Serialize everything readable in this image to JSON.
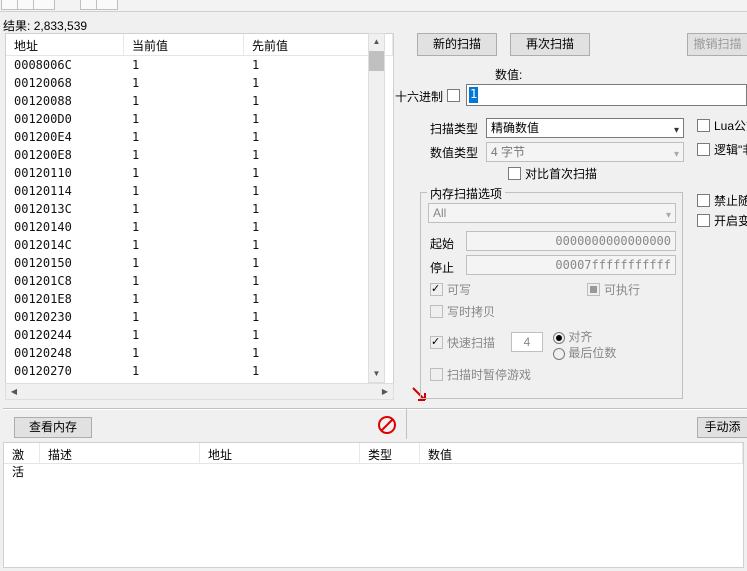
{
  "result_label_prefix": "结果:",
  "result_count": "2,833,539",
  "columns": {
    "addr": "地址",
    "curr": "当前值",
    "prev": "先前值"
  },
  "rows": [
    {
      "addr": "0008006C",
      "curr": "1",
      "prev": "1"
    },
    {
      "addr": "00120068",
      "curr": "1",
      "prev": "1"
    },
    {
      "addr": "00120088",
      "curr": "1",
      "prev": "1"
    },
    {
      "addr": "001200D0",
      "curr": "1",
      "prev": "1"
    },
    {
      "addr": "001200E4",
      "curr": "1",
      "prev": "1"
    },
    {
      "addr": "001200E8",
      "curr": "1",
      "prev": "1"
    },
    {
      "addr": "00120110",
      "curr": "1",
      "prev": "1"
    },
    {
      "addr": "00120114",
      "curr": "1",
      "prev": "1"
    },
    {
      "addr": "0012013C",
      "curr": "1",
      "prev": "1"
    },
    {
      "addr": "00120140",
      "curr": "1",
      "prev": "1"
    },
    {
      "addr": "0012014C",
      "curr": "1",
      "prev": "1"
    },
    {
      "addr": "00120150",
      "curr": "1",
      "prev": "1"
    },
    {
      "addr": "001201C8",
      "curr": "1",
      "prev": "1"
    },
    {
      "addr": "001201E8",
      "curr": "1",
      "prev": "1"
    },
    {
      "addr": "00120230",
      "curr": "1",
      "prev": "1"
    },
    {
      "addr": "00120244",
      "curr": "1",
      "prev": "1"
    },
    {
      "addr": "00120248",
      "curr": "1",
      "prev": "1"
    },
    {
      "addr": "00120270",
      "curr": "1",
      "prev": "1"
    }
  ],
  "buttons": {
    "new_scan": "新的扫描",
    "next_scan": "再次扫描",
    "undo_scan": "撤销扫描",
    "view_mem": "查看内存",
    "manual_add": "手动添"
  },
  "labels": {
    "value": "数值:",
    "hex": "十六进制",
    "scan_type": "扫描类型",
    "value_type": "数值类型",
    "compare_first": "对比首次扫描",
    "mem_box_title": "内存扫描选项",
    "all": "All",
    "start": "起始",
    "stop": "停止",
    "writable": "可写",
    "executable": "可执行",
    "cow": "写时拷贝",
    "fast_scan": "快速扫描",
    "aligned": "对齐",
    "last_digits": "最后位数",
    "pause_game": "扫描时暂停游戏",
    "lua_formula": "Lua公式",
    "logic_not": "逻辑\"非\"过",
    "no_random": "禁止随机",
    "enable_speed": "开启变速"
  },
  "scan_type_value": "精确数值",
  "value_type_value": "4 字节",
  "value_input": "1",
  "mem_start": "0000000000000000",
  "mem_stop": "00007fffffffffff",
  "fast_align_num": "4",
  "bottom_columns": {
    "active": "激活",
    "desc": "描述",
    "addr": "地址",
    "type": "类型",
    "value": "数值"
  }
}
